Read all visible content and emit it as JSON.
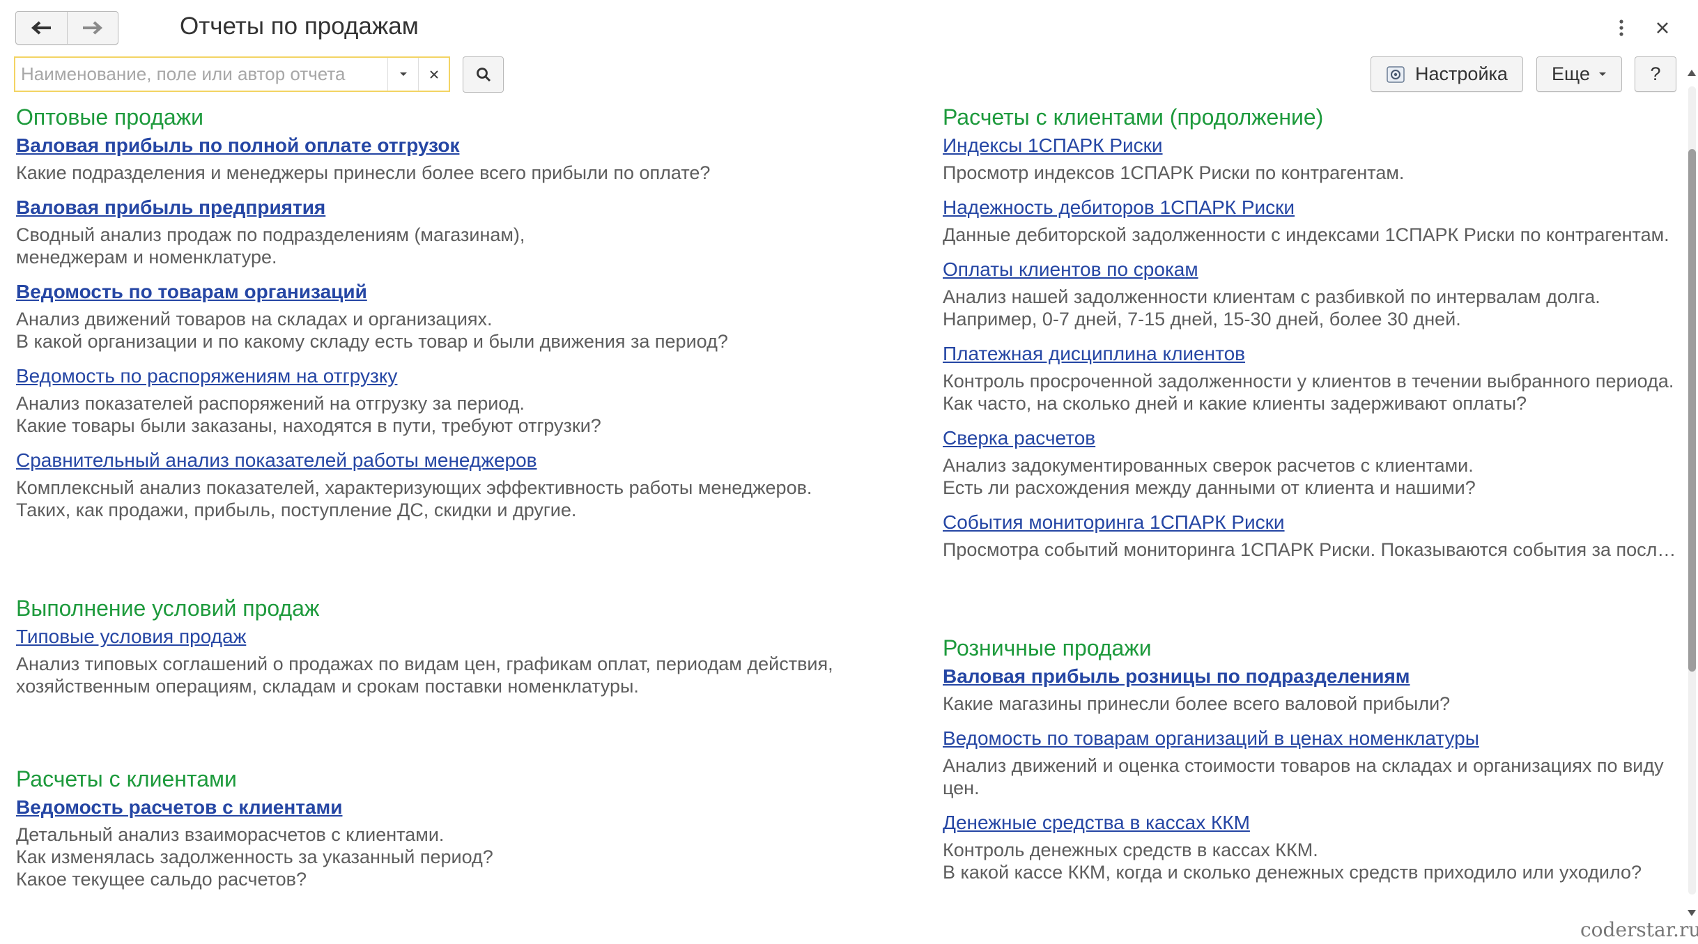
{
  "header": {
    "title": "Отчеты по продажам",
    "back_icon": "arrow-left-icon",
    "forward_icon": "arrow-right-icon",
    "more_icon": "vertical-dots-icon",
    "close_icon": "close-icon"
  },
  "search": {
    "placeholder": "Наименование, поле или автор отчета",
    "value": ""
  },
  "toolbar": {
    "settings_label": "Настройка",
    "more_label": "Еще",
    "help_label": "?"
  },
  "left_sections": [
    {
      "title": "Оптовые продажи",
      "items": [
        {
          "link": "Валовая прибыль по полной оплате отгрузок",
          "desc": "Какие подразделения и менеджеры принесли более всего прибыли по оплате?"
        },
        {
          "link": "Валовая прибыль предприятия",
          "desc": "Сводный анализ продаж по подразделениям (магазинам),\nменеджерам и номенклатуре."
        },
        {
          "link": "Ведомость по товарам организаций",
          "desc": "Анализ движений товаров на складах и организациях.\nВ какой организации и по какому складу есть товар и были движения за период?"
        },
        {
          "link": "Ведомость по распоряжениям на отгрузку",
          "desc": "Анализ показателей распоряжений на отгрузку за период.\nКакие товары были заказаны, находятся в пути, требуют отгрузки?"
        },
        {
          "link": "Сравнительный анализ показателей работы менеджеров",
          "desc": "Комплексный анализ показателей, характеризующих эффективность работы менеджеров.\nТаких, как продажи, прибыль, поступление ДС, скидки и другие."
        }
      ]
    },
    {
      "title": "Выполнение условий продаж",
      "items": [
        {
          "link": "Типовые условия продаж",
          "desc": "Анализ типовых соглашений о продажах по видам цен, графикам оплат, периодам действия,\nхозяйственным операциям, складам и срокам поставки номенклатуры."
        }
      ]
    },
    {
      "title": "Расчеты с клиентами",
      "items": [
        {
          "link": "Ведомость расчетов с клиентами",
          "desc": "Детальный анализ взаиморасчетов с клиентами.\nКак изменялась задолженность за указанный период?\nКакое текущее сальдо расчетов?"
        }
      ]
    }
  ],
  "right_sections": [
    {
      "title": "Расчеты с клиентами (продолжение)",
      "items": [
        {
          "link": "Индексы 1СПАРК Риски",
          "desc": "Просмотр индексов 1СПАРК Риски по контрагентам."
        },
        {
          "link": "Надежность дебиторов 1СПАРК Риски",
          "desc": "Данные дебиторской задолженности с индексами 1СПАРК Риски по контрагентам."
        },
        {
          "link": "Оплаты клиентов по срокам",
          "desc": "Анализ нашей задолженности клиентам с разбивкой по интервалам долга.\nНапример, 0-7 дней, 7-15 дней, 15-30 дней, более 30 дней."
        },
        {
          "link": "Платежная дисциплина клиентов",
          "desc": "Контроль просроченной задолженности у клиентов в течении выбранного периода.\nКак часто, на сколько дней и какие клиенты задерживают оплаты?"
        },
        {
          "link": "Сверка расчетов",
          "desc": "Анализ задокументированных сверок расчетов с клиентами.\nЕсть ли расхождения между данными от клиента и нашими?"
        },
        {
          "link": "События мониторинга 1СПАРК Риски",
          "desc": "Просмотра событий мониторинга 1СПАРК Риски. Показываются события за посл…"
        }
      ]
    },
    {
      "title": "Розничные продажи",
      "items": [
        {
          "link": "Валовая прибыль розницы по подразделениям",
          "desc": "Какие магазины принесли более всего валовой прибыли?"
        },
        {
          "link": "Ведомость по товарам организаций в ценах номенклатуры",
          "desc": "Анализ движений и оценка стоимости товаров на складах и организациях по виду\nцен."
        },
        {
          "link": "Денежные средства в кассах ККМ",
          "desc": "Контроль денежных средств в кассах ККМ.\nВ какой кассе ККМ, когда и сколько денежных средств приходило или уходило?"
        }
      ]
    }
  ],
  "watermark": "coderstar.ru"
}
